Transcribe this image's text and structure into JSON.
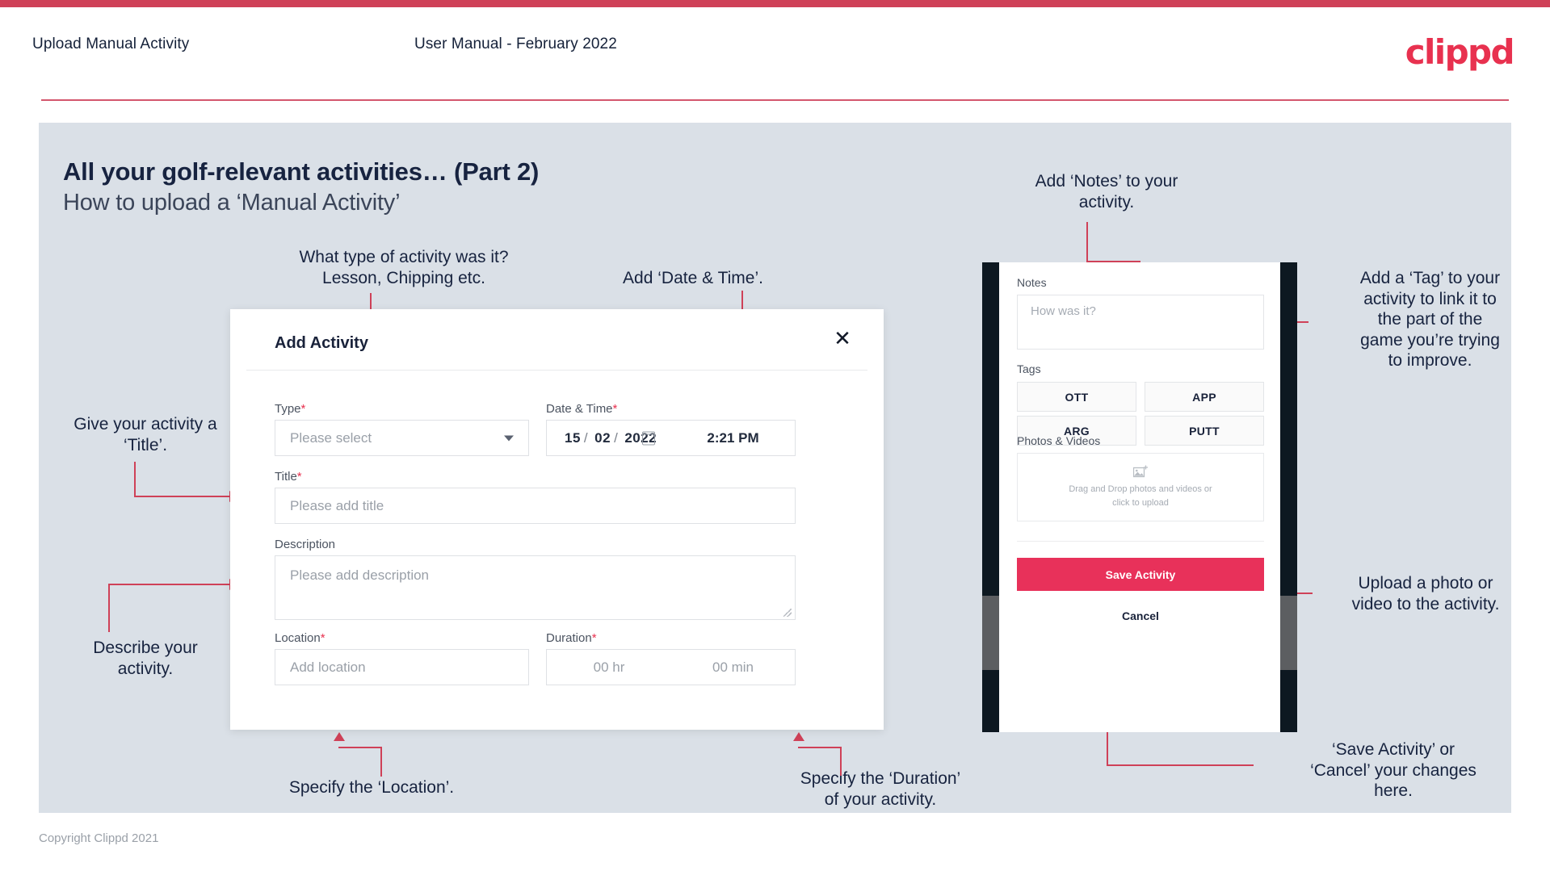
{
  "header": {
    "left_title": "Upload Manual Activity",
    "center_title": "User Manual - February 2022",
    "logo": "clippd"
  },
  "slide": {
    "title": "All your golf-relevant activities… (Part 2)",
    "subtitle": "How to upload a ‘Manual Activity’"
  },
  "dialog": {
    "title": "Add Activity",
    "close_icon": "close-icon",
    "fields": {
      "type": {
        "label": "Type",
        "required": "*",
        "placeholder": "Please select",
        "chevron": "chevron-down-icon"
      },
      "datetime": {
        "label": "Date & Time",
        "required": "*",
        "day": "15",
        "sep1": "/",
        "month": "02",
        "sep2": "/",
        "year": "2022",
        "calendar_icon": "calendar-icon",
        "time": "2:21 PM"
      },
      "title": {
        "label": "Title",
        "required": "*",
        "placeholder": "Please add title"
      },
      "description": {
        "label": "Description",
        "placeholder": "Please add description"
      },
      "location": {
        "label": "Location",
        "required": "*",
        "placeholder": "Add location"
      },
      "duration": {
        "label": "Duration",
        "required": "*",
        "hours": "00 hr",
        "minutes": "00 min"
      }
    }
  },
  "phone": {
    "notes": {
      "label": "Notes",
      "placeholder": "How was it?"
    },
    "tags": {
      "label": "Tags",
      "items": [
        "OTT",
        "APP",
        "ARG",
        "PUTT"
      ]
    },
    "photos": {
      "label": "Photos & Videos",
      "icon": "add-image-icon",
      "dropzone_line1": "Drag and Drop photos and videos or",
      "dropzone_line2": "click to upload"
    },
    "save_label": "Save Activity",
    "cancel_label": "Cancel"
  },
  "annotations": {
    "type": "What type of activity was it?\nLesson, Chipping etc.",
    "datetime": "Add ‘Date & Time’.",
    "title": "Give your activity a\n‘Title’.",
    "description": "Describe your\nactivity.",
    "location": "Specify the ‘Location’.",
    "duration": "Specify the ‘Duration’\nof your activity.",
    "notes": "Add ‘Notes’ to your\nactivity.",
    "tags": "Add a ‘Tag’ to your\nactivity to link it to\nthe part of the\ngame you’re trying\nto improve.",
    "upload": "Upload a photo or\nvideo to the activity.",
    "save": "‘Save Activity’ or\n‘Cancel’ your changes\nhere."
  },
  "footer": "Copyright Clippd 2021",
  "colors": {
    "accent": "#cf4158",
    "brand": "#e8314f",
    "save_button": "#e8315a",
    "slide_bg": "#dae0e7",
    "text_dark": "#17233f"
  }
}
